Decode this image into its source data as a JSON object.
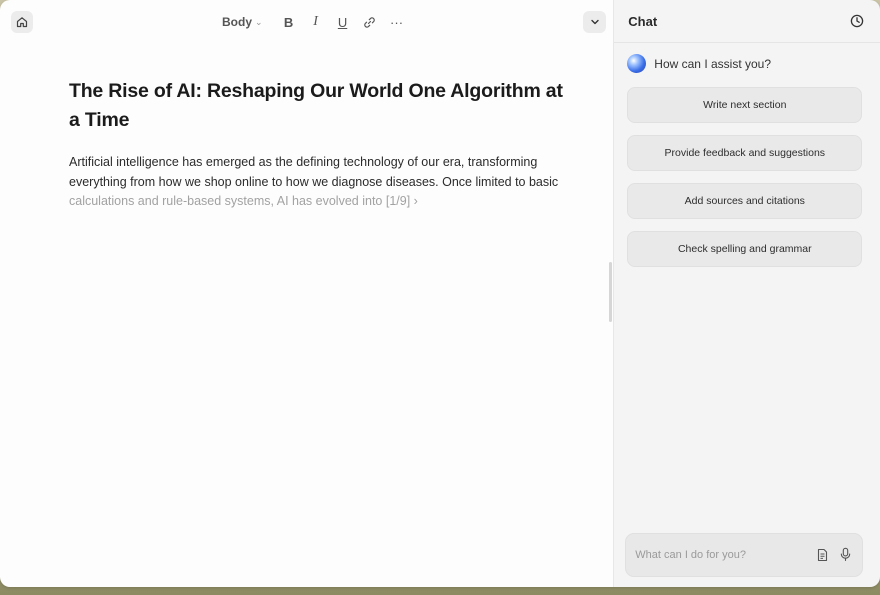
{
  "editor": {
    "toolbar": {
      "style_label": "Body",
      "bold_label": "B",
      "italic_label": "I",
      "underline_label": "U",
      "more_label": "···"
    },
    "title": "The Rise of AI: Reshaping Our World One Algorithm at a Time",
    "body_text": "Artificial intelligence has emerged as the defining technology of our era, transforming everything from how we shop online to how we diagnose diseases. Once limited to basic ",
    "body_faded": "calculations and rule-based systems, AI has evolved into [1/9] ›"
  },
  "chat": {
    "title": "Chat",
    "greeting": "How can I assist you?",
    "suggestions": [
      "Write next section",
      "Provide feedback and suggestions",
      "Add sources and citations",
      "Check spelling and grammar"
    ],
    "input_placeholder": "What can I do for you?"
  },
  "icons": {
    "home": "home-icon",
    "collapse": "chevron-down-icon",
    "history": "clock-icon",
    "attach": "document-icon",
    "mic": "microphone-icon",
    "link": "link-icon"
  },
  "colors": {
    "editor_bg": "#fdfdfd",
    "chat_bg": "#f4f4f4",
    "suggestion_bg": "#e9e9e9",
    "orb_accent": "#3a6ee8"
  }
}
